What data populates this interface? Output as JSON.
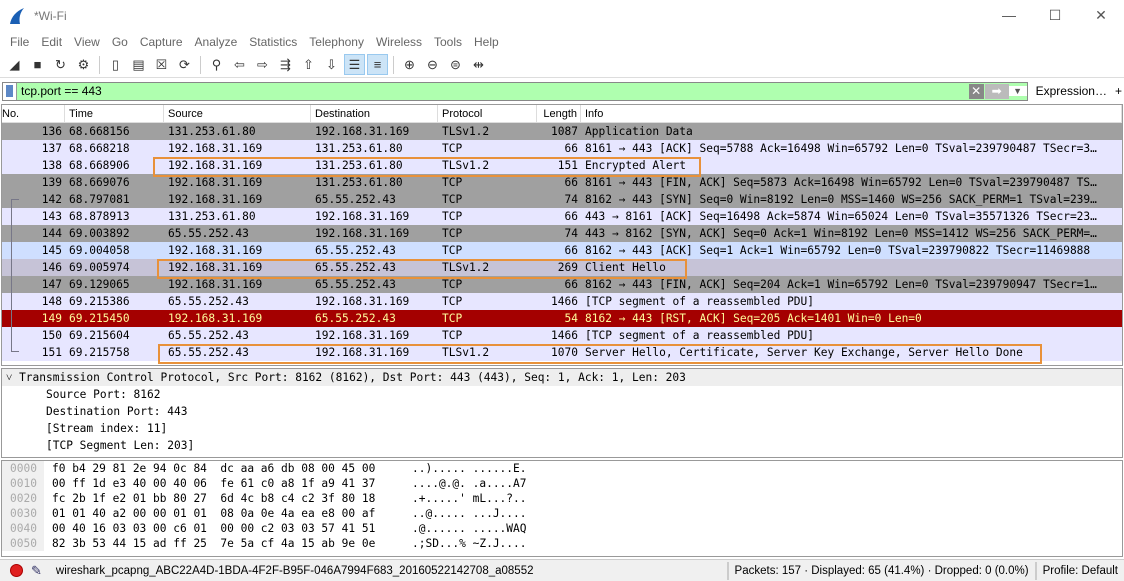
{
  "window": {
    "title": "*Wi-Fi",
    "controls": [
      "—",
      "☐",
      "✕"
    ]
  },
  "menu": [
    "File",
    "Edit",
    "View",
    "Go",
    "Capture",
    "Analyze",
    "Statistics",
    "Telephony",
    "Wireless",
    "Tools",
    "Help"
  ],
  "toolbar": [
    {
      "icon": "shark-fin-icon",
      "glyph": "◢"
    },
    {
      "icon": "stop-icon",
      "glyph": "■"
    },
    {
      "icon": "restart-icon",
      "glyph": "↻"
    },
    {
      "icon": "options-gear-icon",
      "glyph": "⚙"
    },
    {
      "icon": "open-folder-icon",
      "glyph": "▯"
    },
    {
      "icon": "save-file-icon",
      "glyph": "▤"
    },
    {
      "icon": "close-file-icon",
      "glyph": "☒"
    },
    {
      "icon": "reload-icon",
      "glyph": "⟳"
    },
    {
      "icon": "find-icon",
      "glyph": "⚲"
    },
    {
      "icon": "go-back-icon",
      "glyph": "⇦"
    },
    {
      "icon": "go-forward-icon",
      "glyph": "⇨"
    },
    {
      "icon": "go-to-packet-icon",
      "glyph": "⇶"
    },
    {
      "icon": "first-packet-icon",
      "glyph": "⇧"
    },
    {
      "icon": "last-packet-icon",
      "glyph": "⇩"
    },
    {
      "icon": "autoscroll-icon",
      "glyph": "☰",
      "on": true
    },
    {
      "icon": "colorize-icon",
      "glyph": "≡",
      "on": true
    },
    {
      "icon": "zoom-in-icon",
      "glyph": "⊕"
    },
    {
      "icon": "zoom-out-icon",
      "glyph": "⊖"
    },
    {
      "icon": "zoom-normal-icon",
      "glyph": "⊜"
    },
    {
      "icon": "resize-columns-icon",
      "glyph": "⇹"
    }
  ],
  "filter": {
    "value": "tcp.port == 443",
    "clear": "✕",
    "apply": "➡",
    "dropdown": "▼",
    "expression": "Expression…",
    "plus": "+",
    "color": "#afffaf"
  },
  "columns": [
    "No.",
    "Time",
    "Source",
    "Destination",
    "Protocol",
    "Length",
    "Info"
  ],
  "packets": [
    {
      "no": "136",
      "time": "68.668156",
      "src": "131.253.61.80",
      "dst": "192.168.31.169",
      "proto": "TLSv1.2",
      "len": "1087",
      "info": "Application Data",
      "color": "g"
    },
    {
      "no": "137",
      "time": "68.668218",
      "src": "192.168.31.169",
      "dst": "131.253.61.80",
      "proto": "TCP",
      "len": "66",
      "info": "8161 → 443 [ACK] Seq=5788 Ack=16498 Win=65792 Len=0 TSval=239790487 TSecr=3…",
      "color": "l"
    },
    {
      "no": "138",
      "time": "68.668906",
      "src": "192.168.31.169",
      "dst": "131.253.61.80",
      "proto": "TLSv1.2",
      "len": "151",
      "info": "Encrypted Alert",
      "color": "l",
      "highlight": true
    },
    {
      "no": "139",
      "time": "68.669076",
      "src": "192.168.31.169",
      "dst": "131.253.61.80",
      "proto": "TCP",
      "len": "66",
      "info": "8161 → 443 [FIN, ACK] Seq=5873 Ack=16498 Win=65792 Len=0 TSval=239790487 TS…",
      "color": "g"
    },
    {
      "no": "142",
      "time": "68.797081",
      "src": "192.168.31.169",
      "dst": "65.55.252.43",
      "proto": "TCP",
      "len": "74",
      "info": "8162 → 443 [SYN] Seq=0 Win=8192 Len=0 MSS=1460 WS=256 SACK_PERM=1 TSval=239…",
      "color": "g"
    },
    {
      "no": "143",
      "time": "68.878913",
      "src": "131.253.61.80",
      "dst": "192.168.31.169",
      "proto": "TCP",
      "len": "66",
      "info": "443 → 8161 [ACK] Seq=16498 Ack=5874 Win=65024 Len=0 TSval=35571326 TSecr=23…",
      "color": "l"
    },
    {
      "no": "144",
      "time": "69.003892",
      "src": "65.55.252.43",
      "dst": "192.168.31.169",
      "proto": "TCP",
      "len": "74",
      "info": "443 → 8162 [SYN, ACK] Seq=0 Ack=1 Win=8192 Len=0 MSS=1412 WS=256 SACK_PERM=…",
      "color": "g"
    },
    {
      "no": "145",
      "time": "69.004058",
      "src": "192.168.31.169",
      "dst": "65.55.252.43",
      "proto": "TCP",
      "len": "66",
      "info": "8162 → 443 [ACK] Seq=1 Ack=1 Win=65792 Len=0 TSval=239790822 TSecr=11469888",
      "color": "b"
    },
    {
      "no": "146",
      "time": "69.005974",
      "src": "192.168.31.169",
      "dst": "65.55.252.43",
      "proto": "TLSv1.2",
      "len": "269",
      "info": "Client Hello",
      "color": "s",
      "highlight": true
    },
    {
      "no": "147",
      "time": "69.129065",
      "src": "192.168.31.169",
      "dst": "65.55.252.43",
      "proto": "TCP",
      "len": "66",
      "info": "8162 → 443 [FIN, ACK] Seq=204 Ack=1 Win=65792 Len=0 TSval=239790947 TSecr=1…",
      "color": "g"
    },
    {
      "no": "148",
      "time": "69.215386",
      "src": "65.55.252.43",
      "dst": "192.168.31.169",
      "proto": "TCP",
      "len": "1466",
      "info": "[TCP segment of a reassembled PDU]",
      "color": "l"
    },
    {
      "no": "149",
      "time": "69.215450",
      "src": "192.168.31.169",
      "dst": "65.55.252.43",
      "proto": "TCP",
      "len": "54",
      "info": "8162 → 443 [RST, ACK] Seq=205 Ack=1401 Win=0 Len=0",
      "color": "r"
    },
    {
      "no": "150",
      "time": "69.215604",
      "src": "65.55.252.43",
      "dst": "192.168.31.169",
      "proto": "TCP",
      "len": "1466",
      "info": "[TCP segment of a reassembled PDU]",
      "color": "l"
    },
    {
      "no": "151",
      "time": "69.215758",
      "src": "65.55.252.43",
      "dst": "192.168.31.169",
      "proto": "TLSv1.2",
      "len": "1070",
      "info": "Server Hello, Certificate, Server Key Exchange, Server Hello Done",
      "color": "l",
      "highlight": true
    }
  ],
  "details": {
    "header": "Transmission Control Protocol, Src Port: 8162 (8162), Dst Port: 443 (443), Seq: 1, Ack: 1, Len: 203",
    "expander": "˅",
    "fields": [
      "Source Port: 8162",
      "Destination Port: 443",
      "[Stream index: 11]",
      "[TCP Segment Len: 203]"
    ]
  },
  "hex": [
    {
      "off": "0000",
      "hex": "f0 b4 29 81 2e 94 0c 84  dc aa a6 db 08 00 45 00",
      "ascii": "..)..... ......E."
    },
    {
      "off": "0010",
      "hex": "00 ff 1d e3 40 00 40 06  fe 61 c0 a8 1f a9 41 37",
      "ascii": "....@.@. .a....A7"
    },
    {
      "off": "0020",
      "hex": "fc 2b 1f e2 01 bb 80 27  6d 4c b8 c4 c2 3f 80 18",
      "ascii": ".+.....' mL...?.."
    },
    {
      "off": "0030",
      "hex": "01 01 40 a2 00 00 01 01  08 0a 0e 4a ea e8 00 af",
      "ascii": "..@..... ...J...."
    },
    {
      "off": "0040",
      "hex": "00 40 16 03 03 00 c6 01  00 00 c2 03 03 57 41 51",
      "ascii": ".@...... .....WAQ"
    },
    {
      "off": "0050",
      "hex": "82 3b 53 44 15 ad ff 25  7e 5a cf 4a 15 ab 9e 0e",
      "ascii": ".;SD...% ~Z.J...."
    }
  ],
  "status": {
    "file": "wireshark_pcapng_ABC22A4D-1BDA-4F2F-B95F-046A7994F683_20160522142708_a08552",
    "packets": "Packets: 157 · Displayed: 65 (41.4%) · Dropped: 0 (0.0%)",
    "profile": "Profile: Default"
  },
  "colors": {
    "highlight": "#e8913a",
    "rst_bg": "#a40000",
    "rst_fg": "#fffc9c",
    "tcp_bg": "#e7e6ff",
    "gray_bg": "#a0a0a0"
  }
}
